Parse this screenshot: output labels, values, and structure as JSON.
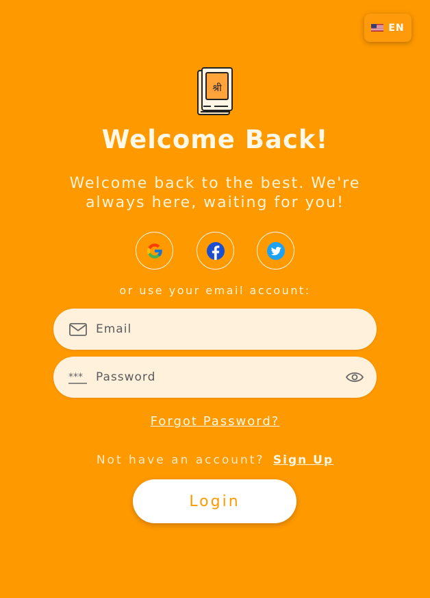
{
  "language": {
    "code": "EN",
    "flag_icon": "us-flag-icon"
  },
  "logo": {
    "icon": "book-icon",
    "glyph": "श्री"
  },
  "title": "Welcome Back!",
  "subtitle": "Welcome back to the best. We're always here, waiting for you!",
  "social": [
    {
      "name": "google",
      "icon": "google-icon"
    },
    {
      "name": "facebook",
      "icon": "facebook-icon"
    },
    {
      "name": "twitter",
      "icon": "twitter-icon"
    }
  ],
  "divider_text": "or use your email account:",
  "email": {
    "placeholder": "Email",
    "icon": "mail-icon"
  },
  "password": {
    "placeholder": "Password",
    "icon": "password-icon",
    "toggle_icon": "eye-icon"
  },
  "forgot_label": "Forgot Password?",
  "signup": {
    "prompt": "Not have an account?",
    "link": "Sign Up"
  },
  "login_label": "Login",
  "colors": {
    "background": "#FF9900",
    "field": "#FFF1DC",
    "button": "#FFFFFF"
  }
}
